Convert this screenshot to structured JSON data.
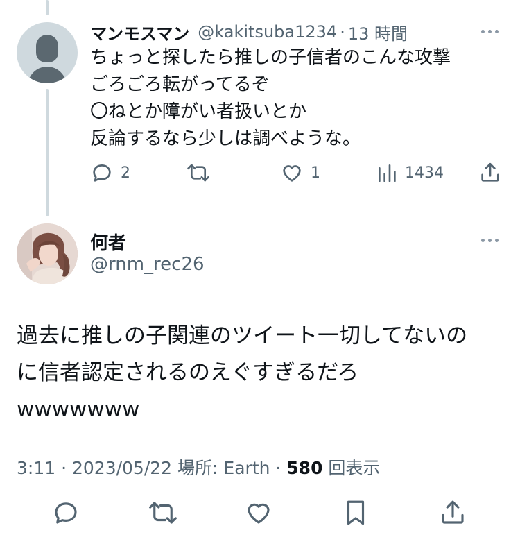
{
  "reply": {
    "name": "マンモスマン",
    "handle": "@kakitsuba1234",
    "separator": "·",
    "time": "13 時間",
    "lines": [
      "ちょっと探したら推しの子信者のこんな攻撃",
      "ごろごろ転がってるぞ",
      "〇ねとか障がい者扱いとか",
      "反論するなら少しは調べような。"
    ],
    "actions": {
      "replies": "2",
      "likes": "1",
      "views": "1434"
    }
  },
  "main": {
    "name": "何者",
    "handle": "@rnm_rec26",
    "lines": [
      "過去に推しの子関連のツイート一切してないの",
      "に信者認定されるのえぐすぎるだろ",
      "wwwwwww"
    ],
    "meta": {
      "time": "3:11",
      "sep1": " · ",
      "date": "2023/05/22",
      "location": " 場所: Earth",
      "sep2": " · ",
      "views_count": "580",
      "views_label": " 回表示"
    }
  },
  "colors": {
    "text": "#0f1419",
    "secondary": "#536471",
    "thread_line": "#cfd9de"
  },
  "icons": {
    "reply": "reply-bubble-icon",
    "retweet": "retweet-icon",
    "like": "heart-icon",
    "views": "views-bar-chart-icon",
    "share": "share-upload-icon",
    "bookmark": "bookmark-icon",
    "more": "more-dots-icon"
  }
}
